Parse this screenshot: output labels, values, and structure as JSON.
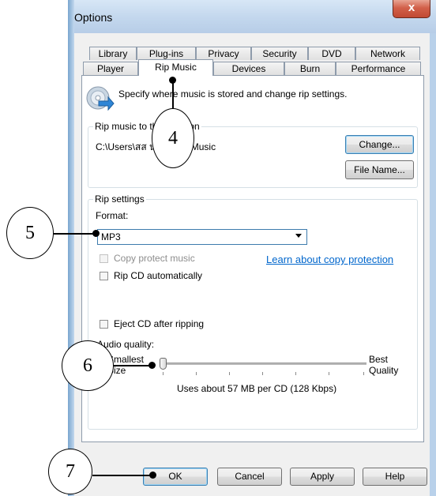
{
  "window": {
    "title": "Options",
    "close_label": "x"
  },
  "tabs_row1": [
    "Library",
    "Plug-ins",
    "Privacy",
    "Security",
    "DVD",
    "Network"
  ],
  "tabs_row2": [
    "Player",
    "Rip Music",
    "Devices",
    "Burn",
    "Performance"
  ],
  "active_tab": "Rip Music",
  "header": {
    "description": "Specify where music is stored and change rip settings."
  },
  "location": {
    "group_title": "Rip music to this location",
    "path": "C:\\Users\\สส   นพลเรือน\\Music",
    "change_label": "Change...",
    "filename_label": "File Name..."
  },
  "rip_settings": {
    "group_title": "Rip settings",
    "format_label": "Format:",
    "format_value": "MP3",
    "copy_protect_label": "Copy protect music",
    "learn_link": "Learn about copy protection",
    "rip_auto_label": "Rip CD automatically",
    "eject_label": "Eject CD after ripping",
    "audio_quality_label": "Audio quality:",
    "smallest_label": "Smallest",
    "size_label": "Size",
    "best_label": "Best",
    "quality_label": "Quality",
    "usage_text": "Uses about 57 MB per CD (128 Kbps)",
    "slider_level": 0
  },
  "footer": {
    "ok": "OK",
    "cancel": "Cancel",
    "apply": "Apply",
    "help": "Help"
  },
  "callouts": [
    "4",
    "5",
    "6",
    "7"
  ]
}
